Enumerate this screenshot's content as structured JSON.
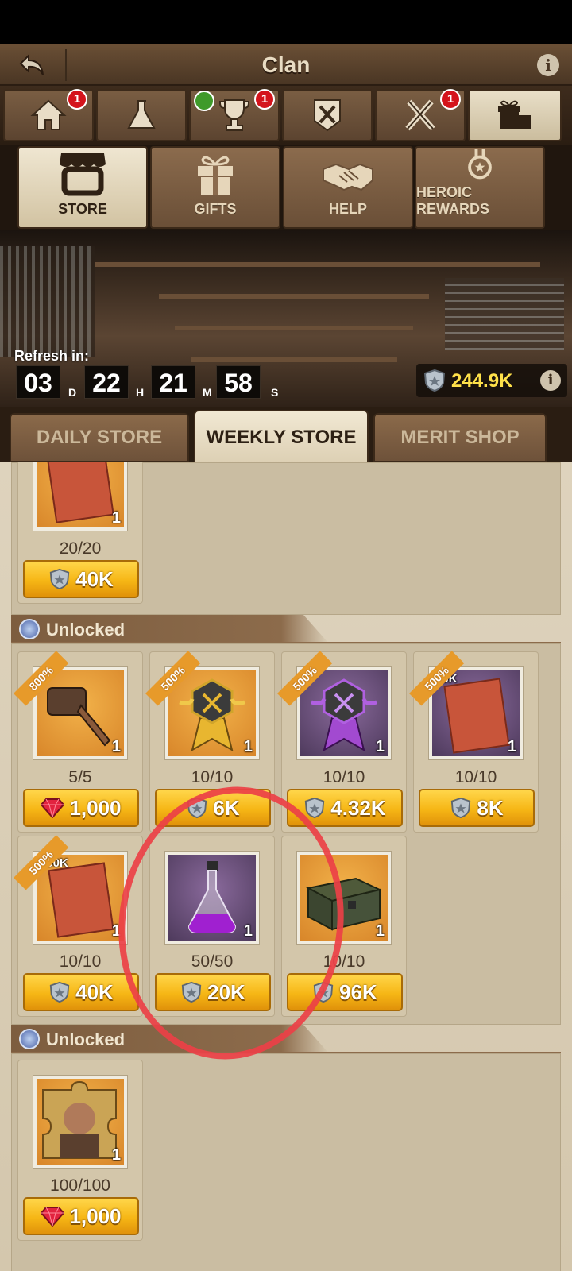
{
  "header": {
    "title": "Clan"
  },
  "top_tabs": [
    {
      "name": "home",
      "badge": "1"
    },
    {
      "name": "research",
      "badge": ""
    },
    {
      "name": "trophy",
      "badge": "1"
    },
    {
      "name": "crafting",
      "badge": ""
    },
    {
      "name": "war",
      "badge": "1"
    },
    {
      "name": "gifts-store",
      "badge": ""
    }
  ],
  "sub_tabs": [
    {
      "label": "STORE"
    },
    {
      "label": "GIFTS"
    },
    {
      "label": "HELP"
    },
    {
      "label": "HEROIC REWARDS"
    }
  ],
  "banner": {
    "refresh_label": "Refresh in:",
    "timer": {
      "d": "03",
      "d_unit": "D",
      "h": "22",
      "h_unit": "H",
      "m": "21",
      "m_unit": "M",
      "s": "58",
      "s_unit": "S"
    },
    "currency_value": "244.9K"
  },
  "store_tabs": [
    {
      "label": "DAILY STORE"
    },
    {
      "label": "WEEKLY STORE"
    },
    {
      "label": "MERIT SHOP"
    }
  ],
  "sections": [
    {
      "label": "Unlocked"
    },
    {
      "label": "Unlocked"
    }
  ],
  "items": [
    {
      "name": "exp-book",
      "qty": "1",
      "limit": "20/20",
      "price": "40K",
      "currency": "merit"
    },
    {
      "name": "key",
      "qty": "1",
      "limit": "5/5",
      "price": "1,000",
      "currency": "gem",
      "ribbon": "800%"
    },
    {
      "name": "gold-medal",
      "qty": "1",
      "limit": "10/10",
      "price": "6K",
      "currency": "merit",
      "ribbon": "500%"
    },
    {
      "name": "purple-medal",
      "qty": "1",
      "limit": "10/10",
      "price": "4.32K",
      "currency": "merit",
      "ribbon": "500%"
    },
    {
      "name": "exp-book-20k",
      "qty": "1",
      "limit": "10/10",
      "price": "8K",
      "currency": "merit",
      "ribbon": "500%",
      "top_label": "20K"
    },
    {
      "name": "exp-book-100k",
      "qty": "1",
      "limit": "10/10",
      "price": "40K",
      "currency": "merit",
      "ribbon": "500%",
      "top_label": "100K"
    },
    {
      "name": "potion",
      "qty": "1",
      "limit": "50/50",
      "price": "20K",
      "currency": "merit"
    },
    {
      "name": "ammo-crate",
      "qty": "1",
      "limit": "10/10",
      "price": "96K",
      "currency": "merit"
    },
    {
      "name": "hero-puzzle",
      "qty": "1",
      "limit": "100/100",
      "price": "1,000",
      "currency": "gem"
    }
  ],
  "colors": {
    "accent": "#f6b615",
    "highlight_circle": "#ec4046",
    "badge": "#d4141c"
  }
}
